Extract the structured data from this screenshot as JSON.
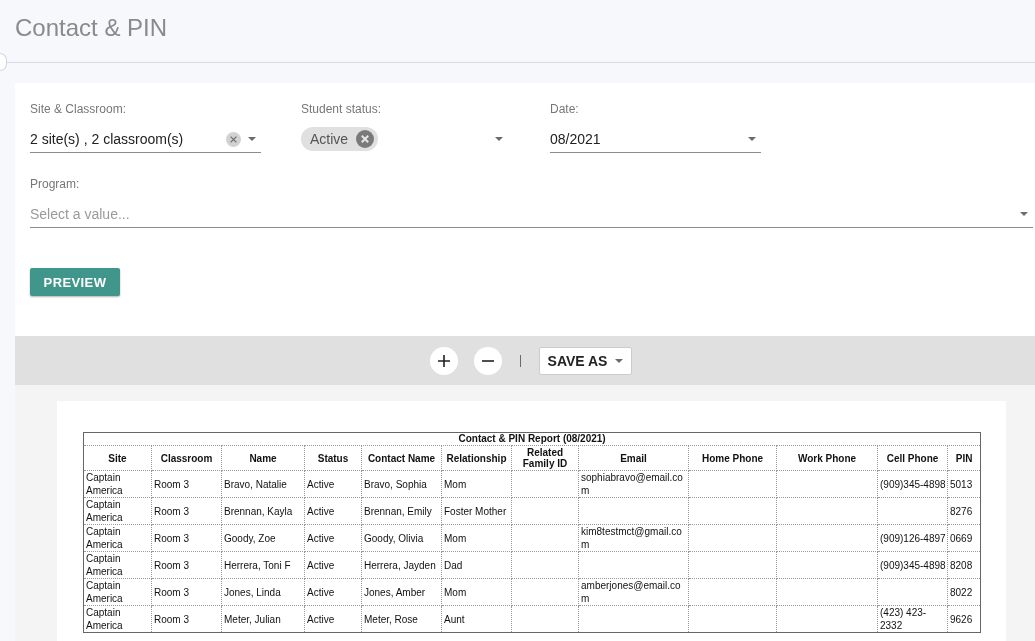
{
  "page": {
    "title": "Contact & PIN"
  },
  "filters": {
    "rows": [
      [
        {
          "kind": "select",
          "label": "Site & Classroom:",
          "value": "2 site(s) , 2 classroom(s)",
          "clearable": true
        },
        {
          "kind": "chips",
          "label": "Student status:",
          "chips": [
            {
              "label": "Active"
            }
          ]
        },
        {
          "kind": "select",
          "label": "Date:",
          "value": "08/2021",
          "clearable": false
        }
      ],
      [
        {
          "kind": "select",
          "label": "Program:",
          "placeholder": "Select a value...",
          "clearable": false
        }
      ]
    ],
    "preview_button": {
      "label": "PREVIEW"
    }
  },
  "toolbar": {
    "save_as": {
      "label": "SAVE AS"
    }
  },
  "report": {
    "title": "Contact & PIN Report (08/2021)",
    "columns": [
      "Site",
      "Classroom",
      "Name",
      "Status",
      "Contact Name",
      "Relationship",
      "Related Family ID",
      "Email",
      "Home Phone",
      "Work Phone",
      "Cell Phone",
      "PIN"
    ],
    "rows": [
      {
        "site": "Captain America",
        "classroom": "Room 3",
        "name": "Bravo, Natalie",
        "status": "Active",
        "contact_name": "Bravo, Sophia",
        "relationship": "Mom",
        "email": "sophiabravo@email.com",
        "cell_phone": "(909)345-4898",
        "pin": "5013"
      },
      {
        "site": "Captain America",
        "classroom": "Room 3",
        "name": "Brennan, Kayla",
        "status": "Active",
        "contact_name": "Brennan, Emily",
        "relationship": "Foster Mother",
        "pin": "8276"
      },
      {
        "site": "Captain America",
        "classroom": "Room 3",
        "name": "Goody, Zoe",
        "status": "Active",
        "contact_name": "Goody, Olivia",
        "relationship": "Mom",
        "email": "kim8testmct@gmail.com",
        "cell_phone": "(909)126-4897",
        "pin": "0669"
      },
      {
        "site": "Captain America",
        "classroom": "Room 3",
        "name": "Herrera, Toni F",
        "status": "Active",
        "contact_name": "Herrera, Jayden",
        "relationship": "Dad",
        "cell_phone": "(909)345-4898",
        "pin": "8208"
      },
      {
        "site": "Captain America",
        "classroom": "Room 3",
        "name": "Jones, Linda",
        "status": "Active",
        "contact_name": "Jones, Amber",
        "relationship": "Mom",
        "email": "amberjones@email.com",
        "pin": "8022"
      },
      {
        "site": "Captain America",
        "classroom": "Room 3",
        "name": "Meter, Julian",
        "status": "Active",
        "contact_name": "Meter, Rose",
        "relationship": "Aunt",
        "cell_phone": "(423) 423-2332",
        "pin": "9626"
      }
    ]
  }
}
